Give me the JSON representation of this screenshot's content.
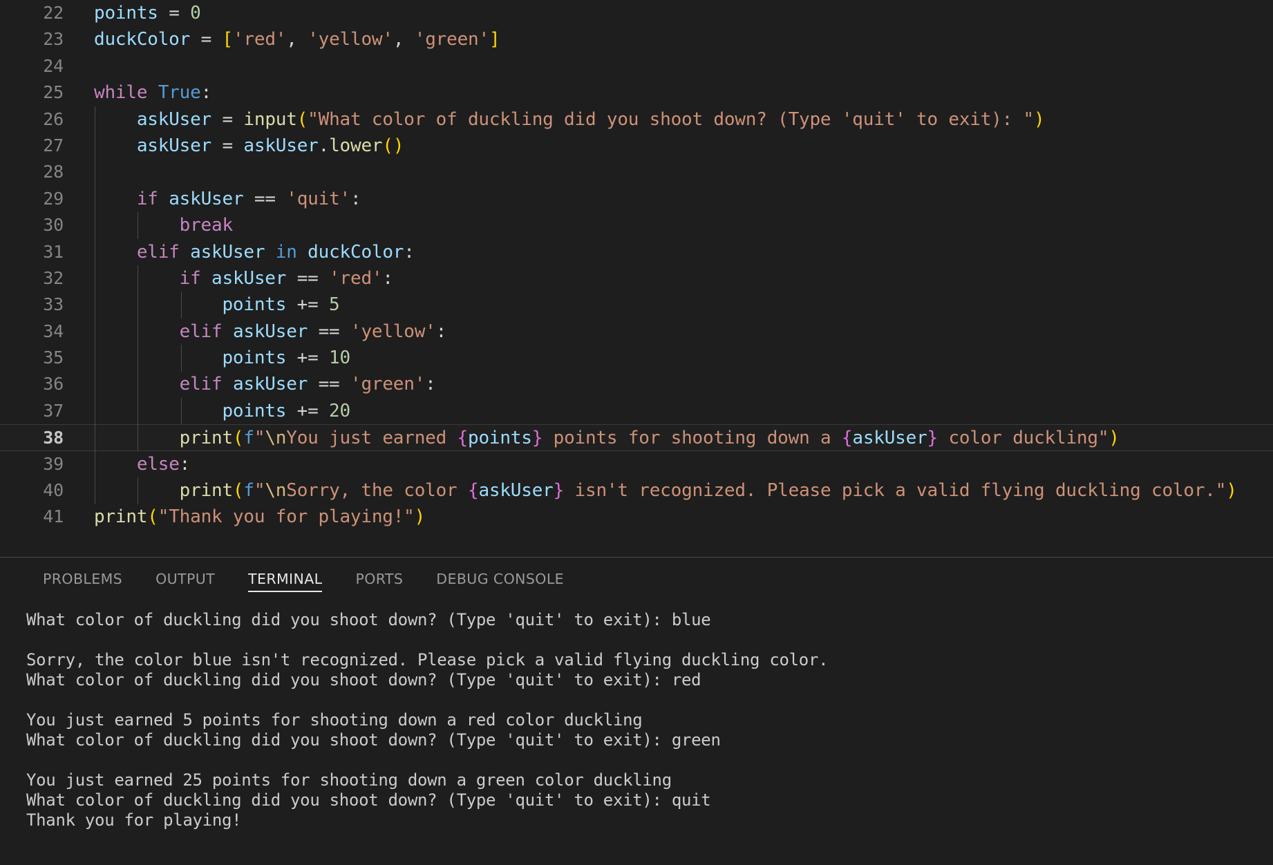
{
  "editor": {
    "language": "python",
    "active_line": 38,
    "first_line": 22,
    "lines": [
      {
        "n": "22",
        "indent": 0,
        "tokens": [
          {
            "t": "points",
            "c": "t-var"
          },
          {
            "t": " ",
            "c": "t-plain"
          },
          {
            "t": "=",
            "c": "t-op"
          },
          {
            "t": " ",
            "c": "t-plain"
          },
          {
            "t": "0",
            "c": "t-num"
          }
        ]
      },
      {
        "n": "23",
        "indent": 0,
        "tokens": [
          {
            "t": "duckColor",
            "c": "t-var"
          },
          {
            "t": " ",
            "c": "t-plain"
          },
          {
            "t": "=",
            "c": "t-op"
          },
          {
            "t": " ",
            "c": "t-plain"
          },
          {
            "t": "[",
            "c": "t-par"
          },
          {
            "t": "'red'",
            "c": "t-str"
          },
          {
            "t": ",",
            "c": "t-plain"
          },
          {
            "t": " ",
            "c": "t-plain"
          },
          {
            "t": "'yellow'",
            "c": "t-str"
          },
          {
            "t": ",",
            "c": "t-plain"
          },
          {
            "t": " ",
            "c": "t-plain"
          },
          {
            "t": "'green'",
            "c": "t-str"
          },
          {
            "t": "]",
            "c": "t-par"
          }
        ]
      },
      {
        "n": "24",
        "indent": 0,
        "tokens": []
      },
      {
        "n": "25",
        "indent": 0,
        "tokens": [
          {
            "t": "while",
            "c": "t-kw"
          },
          {
            "t": " ",
            "c": "t-plain"
          },
          {
            "t": "True",
            "c": "t-blue"
          },
          {
            "t": ":",
            "c": "t-plain"
          }
        ]
      },
      {
        "n": "26",
        "indent": 1,
        "tokens": [
          {
            "t": "    ",
            "c": "t-plain"
          },
          {
            "t": "askUser",
            "c": "t-var"
          },
          {
            "t": " ",
            "c": "t-plain"
          },
          {
            "t": "=",
            "c": "t-op"
          },
          {
            "t": " ",
            "c": "t-plain"
          },
          {
            "t": "input",
            "c": "t-fn"
          },
          {
            "t": "(",
            "c": "t-par"
          },
          {
            "t": "\"What color of duckling did you shoot down? (Type 'quit' to exit): \"",
            "c": "t-str"
          },
          {
            "t": ")",
            "c": "t-par"
          }
        ]
      },
      {
        "n": "27",
        "indent": 1,
        "tokens": [
          {
            "t": "    ",
            "c": "t-plain"
          },
          {
            "t": "askUser",
            "c": "t-var"
          },
          {
            "t": " ",
            "c": "t-plain"
          },
          {
            "t": "=",
            "c": "t-op"
          },
          {
            "t": " ",
            "c": "t-plain"
          },
          {
            "t": "askUser",
            "c": "t-var"
          },
          {
            "t": ".",
            "c": "t-plain"
          },
          {
            "t": "lower",
            "c": "t-fn"
          },
          {
            "t": "()",
            "c": "t-par"
          }
        ]
      },
      {
        "n": "28",
        "indent": 1,
        "tokens": []
      },
      {
        "n": "29",
        "indent": 1,
        "tokens": [
          {
            "t": "    ",
            "c": "t-plain"
          },
          {
            "t": "if",
            "c": "t-kw"
          },
          {
            "t": " ",
            "c": "t-plain"
          },
          {
            "t": "askUser",
            "c": "t-var"
          },
          {
            "t": " ",
            "c": "t-plain"
          },
          {
            "t": "==",
            "c": "t-op"
          },
          {
            "t": " ",
            "c": "t-plain"
          },
          {
            "t": "'quit'",
            "c": "t-str"
          },
          {
            "t": ":",
            "c": "t-plain"
          }
        ]
      },
      {
        "n": "30",
        "indent": 2,
        "tokens": [
          {
            "t": "        ",
            "c": "t-plain"
          },
          {
            "t": "break",
            "c": "t-kw"
          }
        ]
      },
      {
        "n": "31",
        "indent": 1,
        "tokens": [
          {
            "t": "    ",
            "c": "t-plain"
          },
          {
            "t": "elif",
            "c": "t-kw"
          },
          {
            "t": " ",
            "c": "t-plain"
          },
          {
            "t": "askUser",
            "c": "t-var"
          },
          {
            "t": " ",
            "c": "t-plain"
          },
          {
            "t": "in",
            "c": "t-blue"
          },
          {
            "t": " ",
            "c": "t-plain"
          },
          {
            "t": "duckColor",
            "c": "t-var"
          },
          {
            "t": ":",
            "c": "t-plain"
          }
        ]
      },
      {
        "n": "32",
        "indent": 2,
        "tokens": [
          {
            "t": "        ",
            "c": "t-plain"
          },
          {
            "t": "if",
            "c": "t-kw"
          },
          {
            "t": " ",
            "c": "t-plain"
          },
          {
            "t": "askUser",
            "c": "t-var"
          },
          {
            "t": " ",
            "c": "t-plain"
          },
          {
            "t": "==",
            "c": "t-op"
          },
          {
            "t": " ",
            "c": "t-plain"
          },
          {
            "t": "'red'",
            "c": "t-str"
          },
          {
            "t": ":",
            "c": "t-plain"
          }
        ]
      },
      {
        "n": "33",
        "indent": 3,
        "tokens": [
          {
            "t": "            ",
            "c": "t-plain"
          },
          {
            "t": "points",
            "c": "t-var"
          },
          {
            "t": " ",
            "c": "t-plain"
          },
          {
            "t": "+=",
            "c": "t-op"
          },
          {
            "t": " ",
            "c": "t-plain"
          },
          {
            "t": "5",
            "c": "t-num"
          }
        ]
      },
      {
        "n": "34",
        "indent": 2,
        "tokens": [
          {
            "t": "        ",
            "c": "t-plain"
          },
          {
            "t": "elif",
            "c": "t-kw"
          },
          {
            "t": " ",
            "c": "t-plain"
          },
          {
            "t": "askUser",
            "c": "t-var"
          },
          {
            "t": " ",
            "c": "t-plain"
          },
          {
            "t": "==",
            "c": "t-op"
          },
          {
            "t": " ",
            "c": "t-plain"
          },
          {
            "t": "'yellow'",
            "c": "t-str"
          },
          {
            "t": ":",
            "c": "t-plain"
          }
        ]
      },
      {
        "n": "35",
        "indent": 3,
        "tokens": [
          {
            "t": "            ",
            "c": "t-plain"
          },
          {
            "t": "points",
            "c": "t-var"
          },
          {
            "t": " ",
            "c": "t-plain"
          },
          {
            "t": "+=",
            "c": "t-op"
          },
          {
            "t": " ",
            "c": "t-plain"
          },
          {
            "t": "10",
            "c": "t-num"
          }
        ]
      },
      {
        "n": "36",
        "indent": 2,
        "tokens": [
          {
            "t": "        ",
            "c": "t-plain"
          },
          {
            "t": "elif",
            "c": "t-kw"
          },
          {
            "t": " ",
            "c": "t-plain"
          },
          {
            "t": "askUser",
            "c": "t-var"
          },
          {
            "t": " ",
            "c": "t-plain"
          },
          {
            "t": "==",
            "c": "t-op"
          },
          {
            "t": " ",
            "c": "t-plain"
          },
          {
            "t": "'green'",
            "c": "t-str"
          },
          {
            "t": ":",
            "c": "t-plain"
          }
        ]
      },
      {
        "n": "37",
        "indent": 3,
        "tokens": [
          {
            "t": "            ",
            "c": "t-plain"
          },
          {
            "t": "points",
            "c": "t-var"
          },
          {
            "t": " ",
            "c": "t-plain"
          },
          {
            "t": "+=",
            "c": "t-op"
          },
          {
            "t": " ",
            "c": "t-plain"
          },
          {
            "t": "20",
            "c": "t-num"
          }
        ]
      },
      {
        "n": "38",
        "indent": 2,
        "active": true,
        "tokens": [
          {
            "t": "        ",
            "c": "t-plain"
          },
          {
            "t": "print",
            "c": "t-fn"
          },
          {
            "t": "(",
            "c": "t-par"
          },
          {
            "t": "f",
            "c": "t-fpfx"
          },
          {
            "t": "\"",
            "c": "t-str"
          },
          {
            "t": "\\n",
            "c": "t-esc"
          },
          {
            "t": "You just earned ",
            "c": "t-str"
          },
          {
            "t": "{",
            "c": "t-par2"
          },
          {
            "t": "points",
            "c": "t-var"
          },
          {
            "t": "}",
            "c": "t-par2"
          },
          {
            "t": " points for shooting down a ",
            "c": "t-str"
          },
          {
            "t": "{",
            "c": "t-par2"
          },
          {
            "t": "askUser",
            "c": "t-var"
          },
          {
            "t": "}",
            "c": "t-par2"
          },
          {
            "t": " color duckling",
            "c": "t-str"
          },
          {
            "t": "\"",
            "c": "t-str"
          },
          {
            "t": ")",
            "c": "t-par"
          }
        ]
      },
      {
        "n": "39",
        "indent": 1,
        "tokens": [
          {
            "t": "    ",
            "c": "t-plain"
          },
          {
            "t": "else",
            "c": "t-kw"
          },
          {
            "t": ":",
            "c": "t-plain"
          }
        ]
      },
      {
        "n": "40",
        "indent": 2,
        "tokens": [
          {
            "t": "        ",
            "c": "t-plain"
          },
          {
            "t": "print",
            "c": "t-fn"
          },
          {
            "t": "(",
            "c": "t-par"
          },
          {
            "t": "f",
            "c": "t-fpfx"
          },
          {
            "t": "\"",
            "c": "t-str"
          },
          {
            "t": "\\n",
            "c": "t-esc"
          },
          {
            "t": "Sorry, the color ",
            "c": "t-str"
          },
          {
            "t": "{",
            "c": "t-par2"
          },
          {
            "t": "askUser",
            "c": "t-var"
          },
          {
            "t": "}",
            "c": "t-par2"
          },
          {
            "t": " isn't recognized. Please pick a valid flying duckling color.",
            "c": "t-str"
          },
          {
            "t": "\"",
            "c": "t-str"
          },
          {
            "t": ")",
            "c": "t-par"
          }
        ]
      },
      {
        "n": "41",
        "indent": 0,
        "tokens": [
          {
            "t": "print",
            "c": "t-fn"
          },
          {
            "t": "(",
            "c": "t-par"
          },
          {
            "t": "\"Thank you for playing!\"",
            "c": "t-str"
          },
          {
            "t": ")",
            "c": "t-par"
          }
        ]
      }
    ]
  },
  "panel": {
    "tabs": [
      {
        "label": "PROBLEMS",
        "active": false
      },
      {
        "label": "OUTPUT",
        "active": false
      },
      {
        "label": "TERMINAL",
        "active": true
      },
      {
        "label": "PORTS",
        "active": false
      },
      {
        "label": "DEBUG CONSOLE",
        "active": false
      }
    ],
    "terminal_lines": [
      "What color of duckling did you shoot down? (Type 'quit' to exit): blue",
      "",
      "Sorry, the color blue isn't recognized. Please pick a valid flying duckling color.",
      "What color of duckling did you shoot down? (Type 'quit' to exit): red",
      "",
      "You just earned 5 points for shooting down a red color duckling",
      "What color of duckling did you shoot down? (Type 'quit' to exit): green",
      "",
      "You just earned 25 points for shooting down a green color duckling",
      "What color of duckling did you shoot down? (Type 'quit' to exit): quit",
      "Thank you for playing!"
    ]
  },
  "colors": {
    "editor_background": "#1e1e1e",
    "active_line_background": "#202020",
    "line_number": "#858585",
    "active_line_number": "#c6c6c6",
    "keyword": "#c586c0",
    "builtin_constant": "#569cd6",
    "variable": "#9cdcfe",
    "function": "#dcdcaa",
    "string": "#ce9178",
    "number": "#b5cea8",
    "bracket_level1": "#ffd700",
    "bracket_level2": "#da70d6",
    "escape_sequence": "#d7ba7d",
    "terminal_text": "#cccccc",
    "panel_border": "#4a4a4a",
    "tab_inactive": "#9a9a9a",
    "tab_active": "#e7e7e7",
    "indent_guide": "#4a4a4a"
  }
}
